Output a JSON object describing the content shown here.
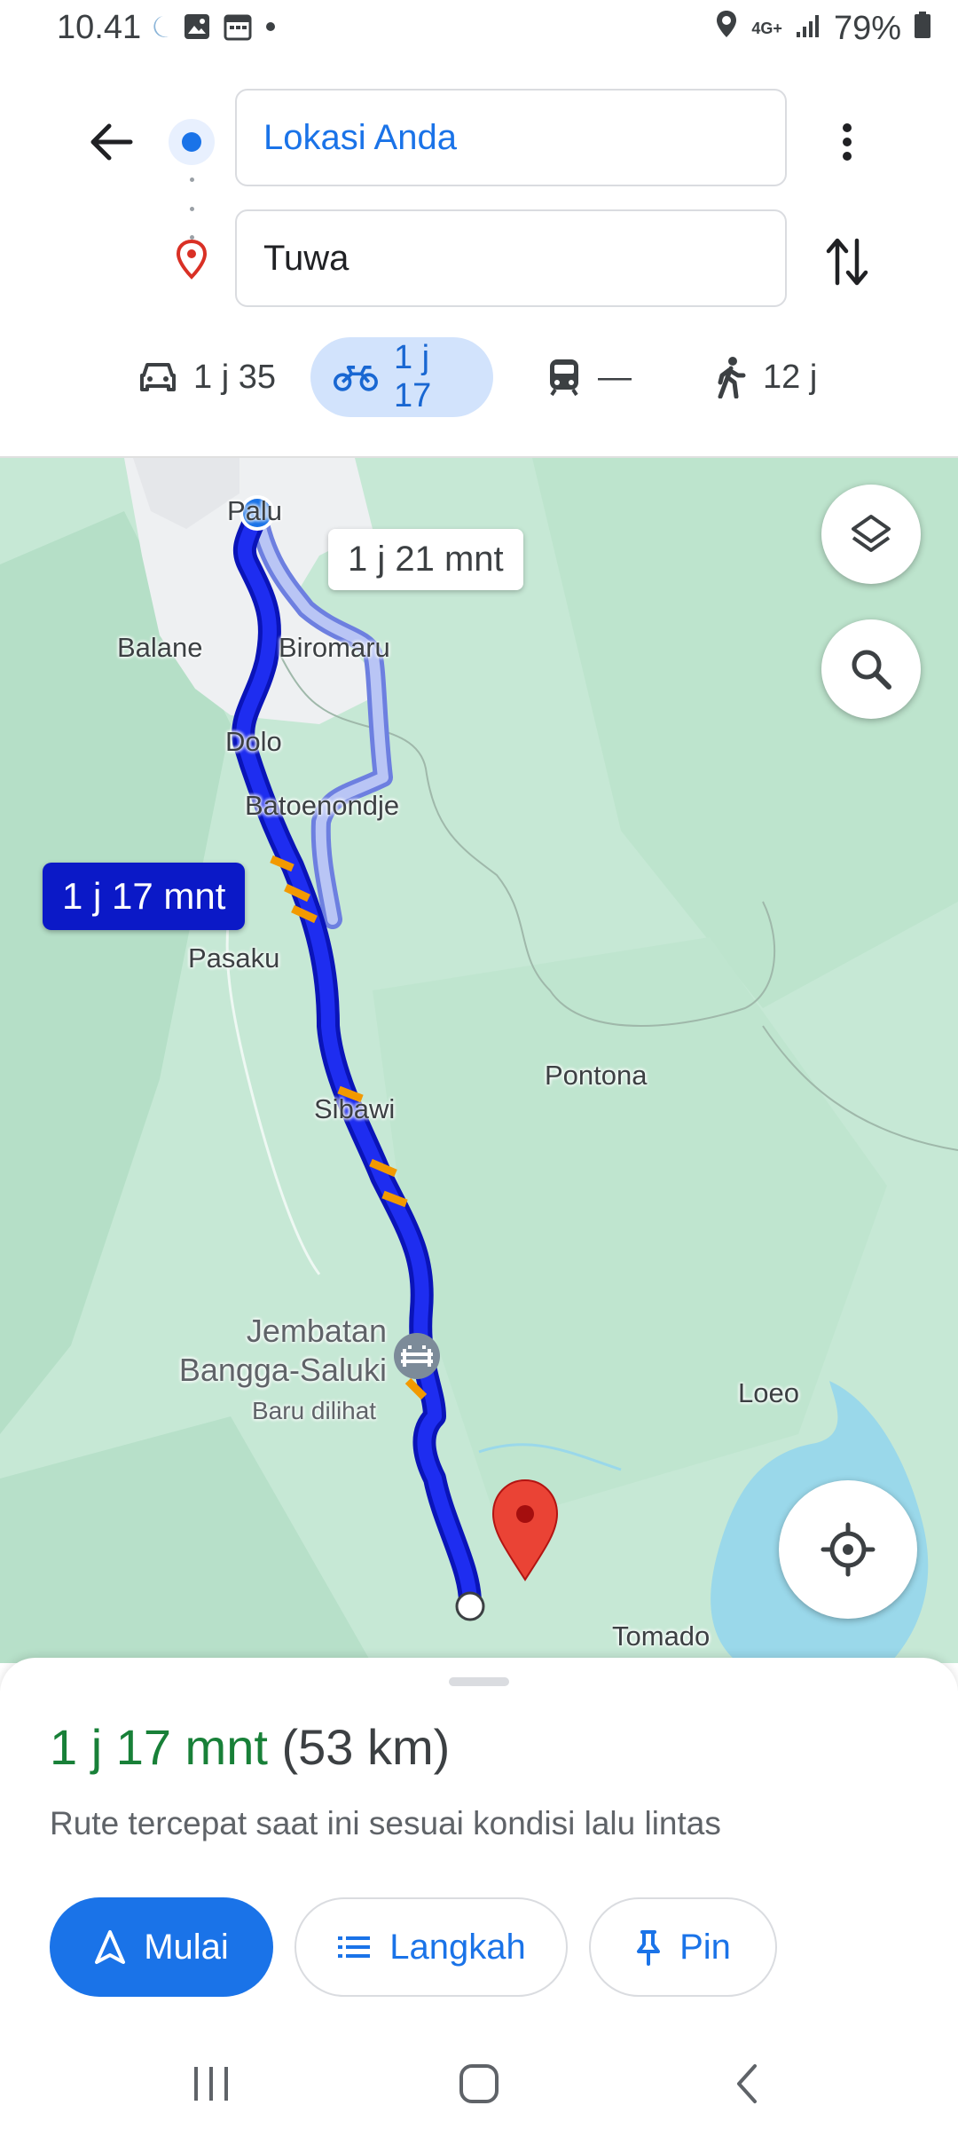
{
  "status_bar": {
    "time": "10.41",
    "network": "4G+",
    "battery": "79%"
  },
  "directions": {
    "origin": "Lokasi Anda",
    "destination": "Tuwa"
  },
  "modes": [
    {
      "icon": "car-icon",
      "label": "1 j 35",
      "selected": false
    },
    {
      "icon": "motorcycle-icon",
      "label": "1 j 17",
      "selected": true
    },
    {
      "icon": "transit-icon",
      "label": "—",
      "selected": false
    },
    {
      "icon": "walk-icon",
      "label": "12 j",
      "selected": false
    }
  ],
  "map": {
    "alt_route_label": "1 j 21 mnt",
    "main_route_label": "1 j 17 mnt",
    "places": {
      "palu": "Palu",
      "balane": "Balane",
      "biromaru": "Biromaru",
      "dolo": "Dolo",
      "batoenondje": "Batoenondje",
      "pasaku": "Pasaku",
      "pontona": "Pontona",
      "sibawi": "Sibawi",
      "jembatan_line1": "Jembatan",
      "jembatan_line2": "Bangga-Saluki",
      "recently_viewed": "Baru dilihat",
      "loeo": "Loeo",
      "tomado": "Tomado"
    }
  },
  "sheet": {
    "duration": "1 j 17 mnt",
    "distance": "(53 km)",
    "description": "Rute tercepat saat ini sesuai kondisi lalu lintas",
    "start_label": "Mulai",
    "steps_label": "Langkah",
    "pin_label": "Pin"
  },
  "colors": {
    "accent": "#1a73e8",
    "route": "#1010e0",
    "duration_green": "#188038",
    "map_green": "#c9ead8",
    "water": "#9ad8ea"
  }
}
